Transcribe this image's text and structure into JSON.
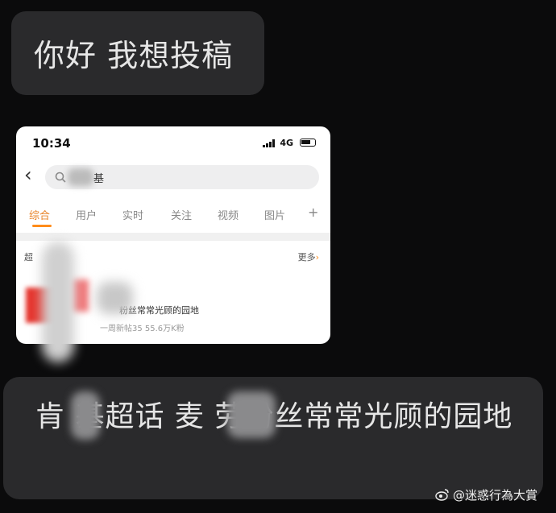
{
  "messages": [
    {
      "text": "你好 我想投稿"
    },
    {
      "text": "肯  基超话 麦   劳粉丝常常光顾的园地"
    }
  ],
  "phone": {
    "time": "10:34",
    "network": "4G",
    "search_query": "基",
    "tabs": [
      "综合",
      "用户",
      "实时",
      "关注",
      "视频",
      "图片",
      "+"
    ],
    "active_tab": "综合",
    "section_label": "超",
    "more_label": "更多",
    "result_title": "粉丝常常光顾的园地",
    "result_meta": "一周新帖35 55.6万K粉"
  },
  "watermark": {
    "text": "@迷惑行為大賞"
  },
  "colors": {
    "accent": "#ff8c1a",
    "bubble": "#2a2a2c",
    "background": "#0b0b0c"
  }
}
